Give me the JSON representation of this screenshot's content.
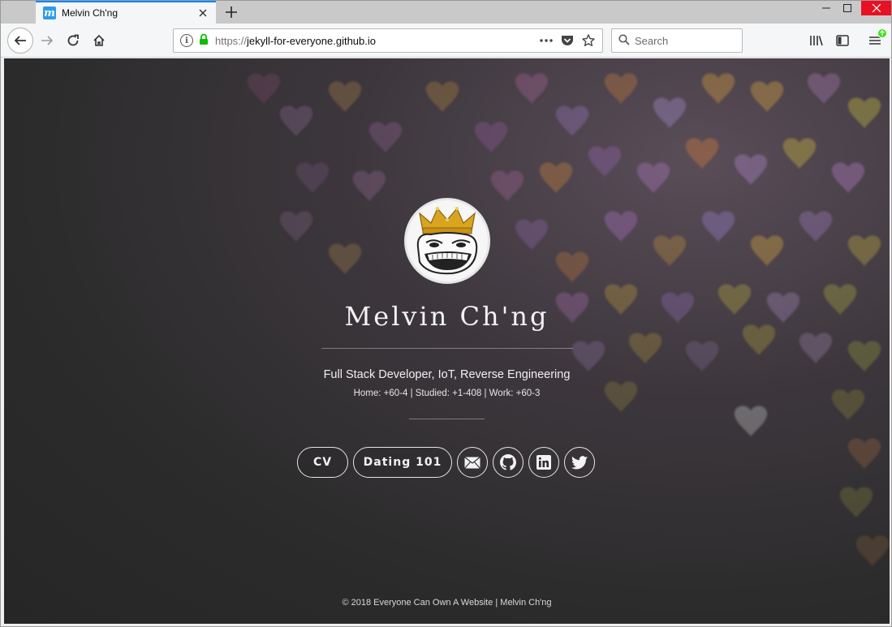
{
  "browser": {
    "tab_title": "Melvin Ch'ng",
    "tab_favicon_letter": "m",
    "url_scheme": "https://",
    "url_host": "jekyll-for-everyone.github.io",
    "search_placeholder": "Search",
    "icons": [
      "back-icon",
      "forward-icon",
      "reload-icon",
      "home-icon",
      "info-icon",
      "lock-icon",
      "more-icon",
      "pocket-icon",
      "bookmark-star-icon",
      "search-icon",
      "library-icon",
      "sidebar-icon",
      "menu-icon",
      "update-icon",
      "close-icon",
      "new-tab-icon",
      "minimize-icon",
      "maximize-icon"
    ],
    "accent_color": "#0a84ff",
    "lock_color": "#12bc00",
    "close_color": "#e81123"
  },
  "page": {
    "title": "Melvin Ch'ng",
    "tagline": "Full Stack Developer, IoT, Reverse Engineering",
    "locations": "Home: +60-4 | Studied: +1-408 | Work: +60-3",
    "buttons": {
      "cv": "CV",
      "dating": "Dating 101"
    },
    "social": [
      "email-icon",
      "github-icon",
      "linkedin-icon",
      "twitter-icon"
    ],
    "footer": "© 2018 Everyone Can Own A Website | Melvin Ch'ng"
  }
}
